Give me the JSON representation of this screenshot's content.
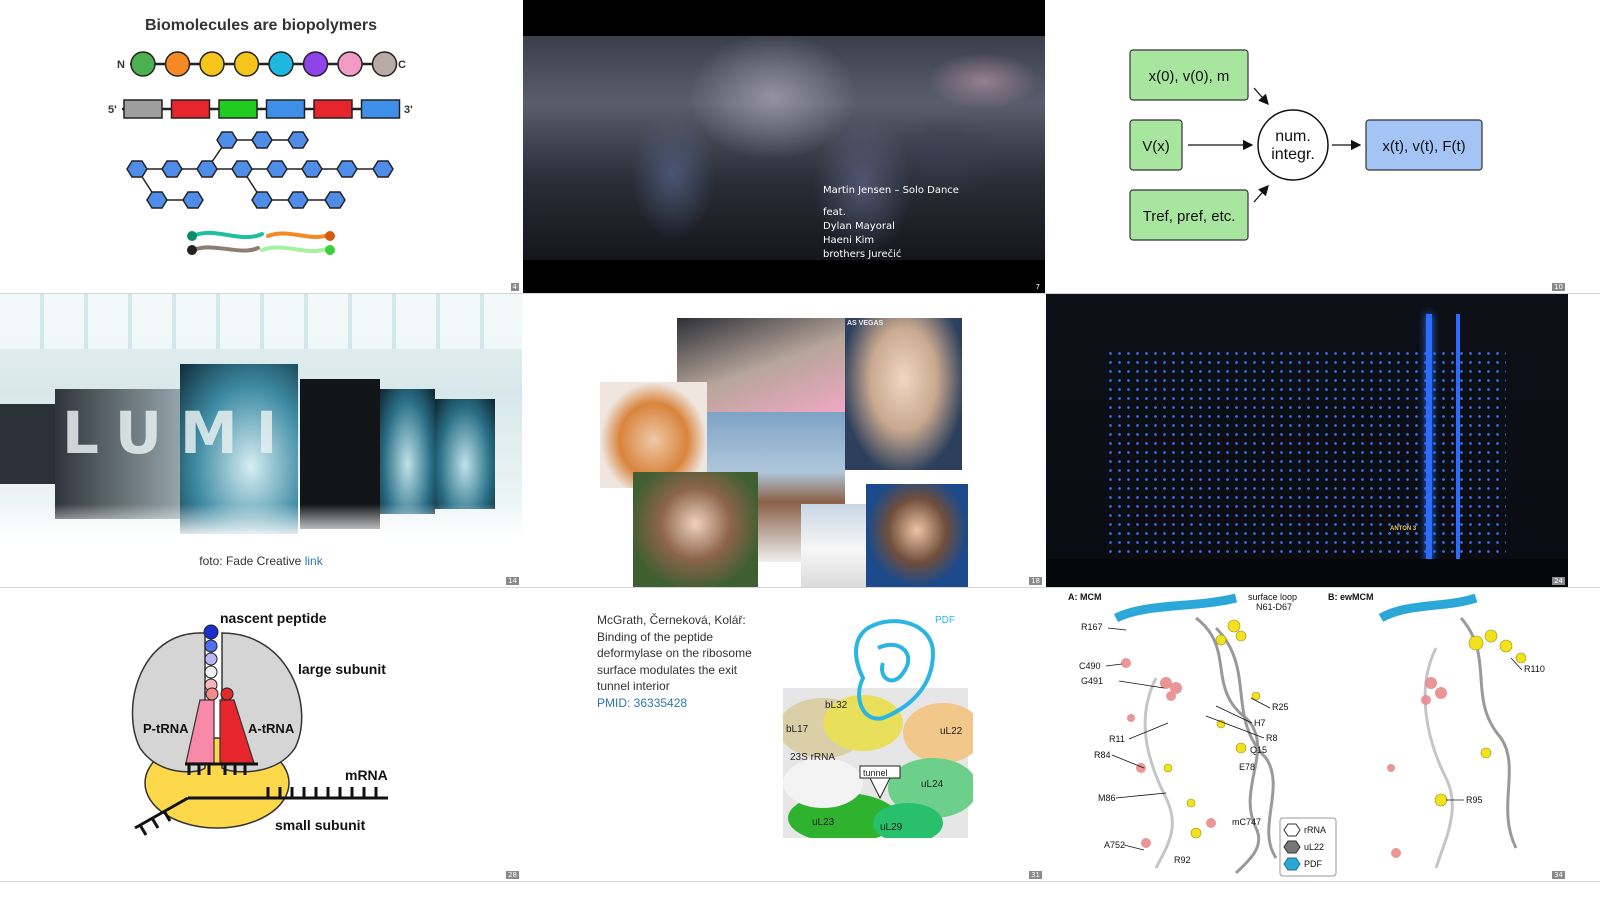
{
  "slides": [
    {
      "number": "4",
      "title": "Biomolecules are biopolymers",
      "labels": {
        "n": "N",
        "c": "C",
        "five": "5'",
        "three": "3'"
      },
      "bead_colors": [
        "#4caf50",
        "#f58a25",
        "#f6c51b",
        "#f6c51b",
        "#1fb6df",
        "#8e44e8",
        "#f39ac5",
        "#b8aaa6"
      ],
      "block_colors": [
        "#9e9e9e",
        "#e6252d",
        "#20cc20",
        "#3f8ee8",
        "#e6252d",
        "#3f8ee8"
      ]
    },
    {
      "number": "7",
      "song": "Martin Jensen – Solo Dance",
      "feat": "feat.",
      "artists": [
        "Dylan Mayoral",
        "Haeni Kim",
        "brothers Jurečić"
      ]
    },
    {
      "number": "10",
      "box_init": "x(0), v(0), m",
      "box_pot": "V(x)",
      "box_ref": "Tref, pref, etc.",
      "circle_1": "num.",
      "circle_2": "integr.",
      "box_out": "x(t), v(t), F(t)"
    },
    {
      "number": "14",
      "caption": "foto: Fade Creative",
      "caption_link": "link",
      "logo_text": "LUMI"
    },
    {
      "number": "18",
      "sign_text": "AS VEGAS"
    },
    {
      "number": "24",
      "anton_label": "ANTON 3"
    },
    {
      "number": "28",
      "nascent": "nascent peptide",
      "large": "large subunit",
      "ptrna": "P-tRNA",
      "atrna": "A-tRNA",
      "mrna": "mRNA",
      "small": "small subunit"
    },
    {
      "number": "31",
      "ref_lines": [
        "McGrath, Černeková, Kolář:",
        "Binding of the peptide",
        "deformylase on the ribosome",
        "surface modulates the exit",
        "tunnel interior"
      ],
      "pmid": "PMID: 36335428",
      "fig": {
        "pdf": "PDF",
        "bl32": "bL32",
        "bl17": "bL17",
        "ul22": "uL22",
        "rrna": "23S rRNA",
        "tunnel": "tunnel",
        "ul24": "uL24",
        "ul23": "uL23",
        "ul29": "uL29"
      }
    },
    {
      "number": "34",
      "panel_a": "A: MCM",
      "panel_b": "B: ewMCM",
      "surface_loop": "surface loop",
      "n61": "N61-D67",
      "left_labels": [
        "R167",
        "C490",
        "G491",
        "R11",
        "R84",
        "M86",
        "A752"
      ],
      "right_labels": [
        "R25",
        "H7",
        "R8",
        "Q15",
        "E78",
        "mC747",
        "R92"
      ],
      "b_labels": [
        "R110",
        "R95"
      ],
      "legend": [
        "rRNA",
        "uL22",
        "PDF"
      ]
    }
  ]
}
